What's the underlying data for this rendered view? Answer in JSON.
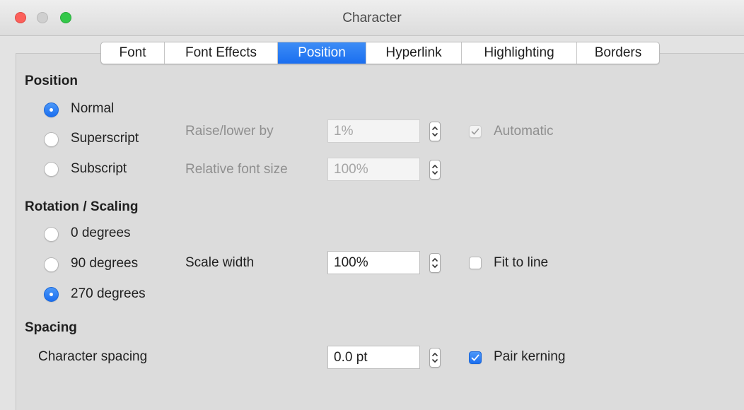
{
  "window": {
    "title": "Character"
  },
  "tabs": [
    {
      "label": "Font",
      "active": false
    },
    {
      "label": "Font Effects",
      "active": false
    },
    {
      "label": "Position",
      "active": true
    },
    {
      "label": "Hyperlink",
      "active": false
    },
    {
      "label": "Highlighting",
      "active": false
    },
    {
      "label": "Borders",
      "active": false
    }
  ],
  "position": {
    "heading": "Position",
    "options": [
      {
        "label": "Normal",
        "selected": true
      },
      {
        "label": "Superscript",
        "selected": false
      },
      {
        "label": "Subscript",
        "selected": false
      }
    ],
    "raise_lower": {
      "label": "Raise/lower by",
      "value": "1%",
      "enabled": false
    },
    "relative_font_size": {
      "label": "Relative font size",
      "value": "100%",
      "enabled": false
    },
    "automatic": {
      "label": "Automatic",
      "checked": true,
      "enabled": false
    }
  },
  "rotation": {
    "heading": "Rotation / Scaling",
    "options": [
      {
        "label": "0 degrees",
        "selected": false
      },
      {
        "label": "90 degrees",
        "selected": false
      },
      {
        "label": "270 degrees",
        "selected": true
      }
    ],
    "scale_width": {
      "label": "Scale width",
      "value": "100%"
    },
    "fit_to_line": {
      "label": "Fit to line",
      "checked": false
    }
  },
  "spacing": {
    "heading": "Spacing",
    "character_spacing": {
      "label": "Character spacing",
      "value": "0.0 pt"
    },
    "pair_kerning": {
      "label": "Pair kerning",
      "checked": true
    }
  },
  "colors": {
    "accent": "#1a6ef0",
    "window_bg": "#e3e3e3",
    "disabled_text": "#8f8f8f"
  }
}
